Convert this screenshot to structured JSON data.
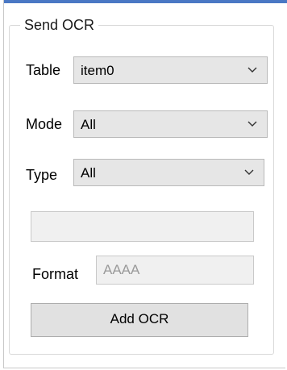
{
  "group": {
    "title": "Send OCR"
  },
  "table": {
    "label": "Table",
    "value": "item0",
    "icon": "chevron-down-icon"
  },
  "mode": {
    "label": "Mode",
    "value": "All",
    "icon": "chevron-down-icon"
  },
  "type": {
    "label": "Type",
    "value": "All",
    "icon": "chevron-down-icon"
  },
  "text_input": {
    "value": ""
  },
  "format": {
    "label": "Format",
    "value": "AAAA"
  },
  "add_button": {
    "label": "Add OCR"
  },
  "colors": {
    "panel_accent": "#4a78c4",
    "control_bg": "#e6e6e6",
    "border": "#b9b9b9"
  }
}
